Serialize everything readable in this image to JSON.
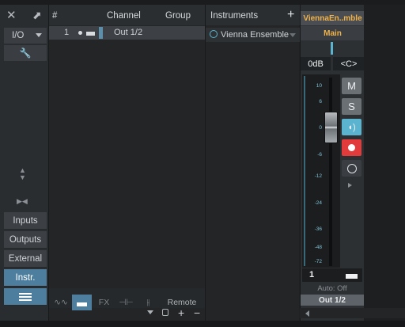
{
  "left_panel": {
    "io_label": "I/O",
    "buttons": [
      {
        "label": "Inputs"
      },
      {
        "label": "Outputs"
      },
      {
        "label": "External"
      },
      {
        "label": "Instr."
      }
    ]
  },
  "track_list": {
    "headers": {
      "number": "#",
      "channel": "Channel",
      "group": "Group"
    },
    "rows": [
      {
        "number": "1",
        "output": "Out 1/2"
      }
    ],
    "toolbar": {
      "fx": "FX",
      "remote": "Remote"
    }
  },
  "instruments": {
    "title": "Instruments",
    "add": "+",
    "items": [
      {
        "name": "Vienna Ensemble"
      }
    ]
  },
  "channel_strip": {
    "name": "ViennaEn..mble",
    "bus": "Main",
    "volume": "0dB",
    "pan": "<C>",
    "scale": [
      "10",
      "6",
      "0",
      "-6",
      "-12",
      "-24",
      "-36",
      "-48",
      "-72"
    ],
    "mute": "M",
    "solo": "S",
    "number": "1",
    "automation": "Auto: Off",
    "output": "Out 1/2",
    "fader_level_db": 0,
    "accent": "#5ab4d0",
    "record_color": "#e23b3b"
  }
}
